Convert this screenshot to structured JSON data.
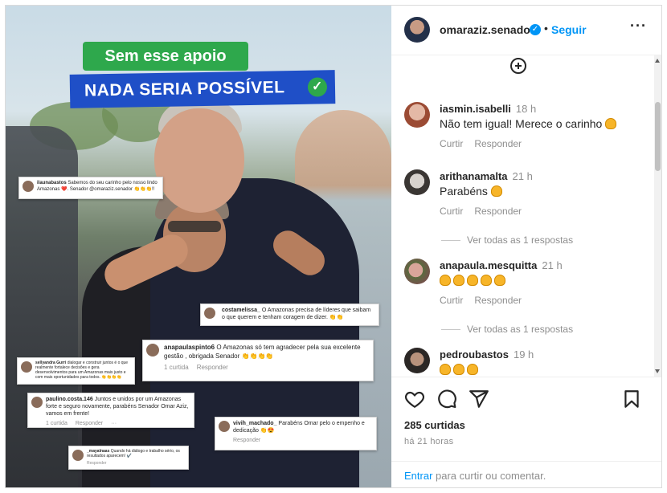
{
  "post": {
    "banner_top": "Sem esse apoio",
    "banner_main": "NADA SERIA POSSÍVEL",
    "check_glyph": "✓",
    "overlay_comments": [
      {
        "user": "ilaunabastos",
        "text": "Sabemos do seu carinho pelo nosso lindo Amazonas ❤️. Senador @omaraziz.senador 👏👏👏!!"
      },
      {
        "user": "costamelissa_",
        "text": "O Amazonas precisa de líderes que saibam o que querem e tenham coragem de dizer. 👏👏"
      },
      {
        "user": "anapaulaspinto6",
        "text": "O Amazonas só tem agradecer pela sua excelente gestão , obrigada Senador 👏👏👏👏",
        "likes": "1 curtida",
        "reply": "Responder"
      },
      {
        "user": "sellyandra Gurri",
        "text": "dialogar e construir juntos é o que realmente fortalece decisões e gera desenvolvimentos para um Amazonas mais justo e com mais oportunidades para todos. 👏👏👏👏"
      },
      {
        "user": "paulino.costa.146",
        "text": "Juntos e unidos por um Amazonas forte e seguro novamente, parabéns Senador Omar Aziz, vamos em frente!",
        "likes": "1 curtida",
        "reply": "Responder",
        "more": "···"
      },
      {
        "user": "vivih_machado_",
        "text": "Parabéns Omar pelo o empenho e dedicação 👏😍",
        "reply": "Responder"
      },
      {
        "user": "_mayalnaas",
        "text": "Quando há diálogo e trabalho sério, os resultados aparecem! ✔️",
        "reply": "Responder"
      }
    ]
  },
  "header": {
    "username": "omaraziz.senador",
    "verified_glyph": "✓",
    "separator": "•",
    "follow_label": "Seguir",
    "more_label": "···"
  },
  "comments": [
    {
      "user": "iasmin.isabelli",
      "time": "18 h",
      "text": "Não tem igual! Merece o carinho",
      "claps": 1,
      "like_label": "Curtir",
      "reply_label": "Responder",
      "avatar_color": "#d9a08a"
    },
    {
      "user": "arithanamalta",
      "time": "21 h",
      "text": "Parabéns",
      "claps": 1,
      "like_label": "Curtir",
      "reply_label": "Responder",
      "replies": "Ver todas as 1 respostas",
      "avatar_color": "#7d7d7d"
    },
    {
      "user": "anapaula.mesquitta",
      "time": "21 h",
      "text": "",
      "claps": 5,
      "like_label": "Curtir",
      "reply_label": "Responder",
      "replies": "Ver todas as 1 respostas",
      "avatar_color": "#b56d69"
    },
    {
      "user": "pedroubastos",
      "time": "19 h",
      "text": "",
      "claps": 3,
      "avatar_color": "#3e3a38"
    }
  ],
  "footer": {
    "likes": "285 curtidas",
    "ago": "há 21 horas",
    "login_link": "Entrar",
    "login_text": " para curtir ou comentar."
  },
  "icons": [
    "heart-icon",
    "comment-icon",
    "share-icon",
    "bookmark-icon",
    "plus-circle-icon",
    "clap-emoji-icon",
    "verified-icon",
    "more-icon"
  ],
  "colors": {
    "accent": "#0095f6",
    "banner_green": "#2ea84c",
    "banner_blue": "#1f4fc7",
    "text": "#262626",
    "muted": "#8e8e8e"
  }
}
